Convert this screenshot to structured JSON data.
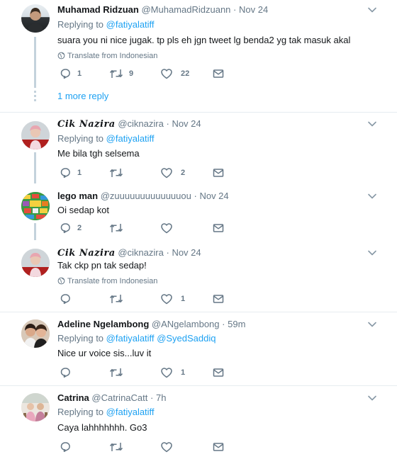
{
  "tweets": [
    {
      "name": "Muhamad Ridzuan",
      "handle": "@MuhamadRidzuann",
      "sep": "·",
      "time": "Nov 24",
      "replying_prefix": "Replying to",
      "mentions": [
        "@fatiyalatiff"
      ],
      "text": "suara you ni nice jugak. tp pls eh jgn tweet lg benda2 yg tak masuk akal",
      "translate": "Translate from Indonesian",
      "replies": "1",
      "retweets": "9",
      "likes": "22",
      "more_replies": "1 more reply"
    },
    {
      "name": "Cik Nazira",
      "handle": "@ciknazira",
      "sep": "·",
      "time": "Nov 24",
      "replying_prefix": "Replying to",
      "mentions": [
        "@fatiyalatiff"
      ],
      "text": "Me bila tgh selsema",
      "replies": "1",
      "retweets": "",
      "likes": "2"
    },
    {
      "name": "lego man",
      "handle": "@zuuuuuuuuuuuuuou",
      "sep": "·",
      "time": "Nov 24",
      "text": "Oi sedap kot",
      "replies": "2",
      "retweets": "",
      "likes": ""
    },
    {
      "name": "Cik Nazira",
      "handle": "@ciknazira",
      "sep": "·",
      "time": "Nov 24",
      "text": "Tak ckp pn tak sedap!",
      "translate": "Translate from Indonesian",
      "replies": "",
      "retweets": "",
      "likes": "1"
    },
    {
      "name": "Adeline Ngelambong",
      "handle": "@ANgelambong",
      "sep": "·",
      "time": "59m",
      "replying_prefix": "Replying to",
      "mentions": [
        "@fatiyalatiff",
        "@SyedSaddiq"
      ],
      "text": "Nice ur voice sis...luv it",
      "replies": "",
      "retweets": "",
      "likes": "1"
    },
    {
      "name": "Catrina",
      "handle": "@CatrinaCatt",
      "sep": "·",
      "time": "7h",
      "replying_prefix": "Replying to",
      "mentions": [
        "@fatiyalatiff"
      ],
      "text": "Caya lahhhhhhh. Go3",
      "replies": "",
      "retweets": "",
      "likes": ""
    }
  ],
  "icons": {
    "reply": "reply-icon",
    "retweet": "retweet-icon",
    "like": "heart-icon",
    "dm": "envelope-icon",
    "caret": "chevron-down-icon",
    "globe": "globe-icon"
  },
  "colors": {
    "link": "#1da1f2",
    "secondary": "#657786",
    "text": "#14171a",
    "thread_line": "#c4d2dc",
    "divider": "#e6ecf0"
  }
}
